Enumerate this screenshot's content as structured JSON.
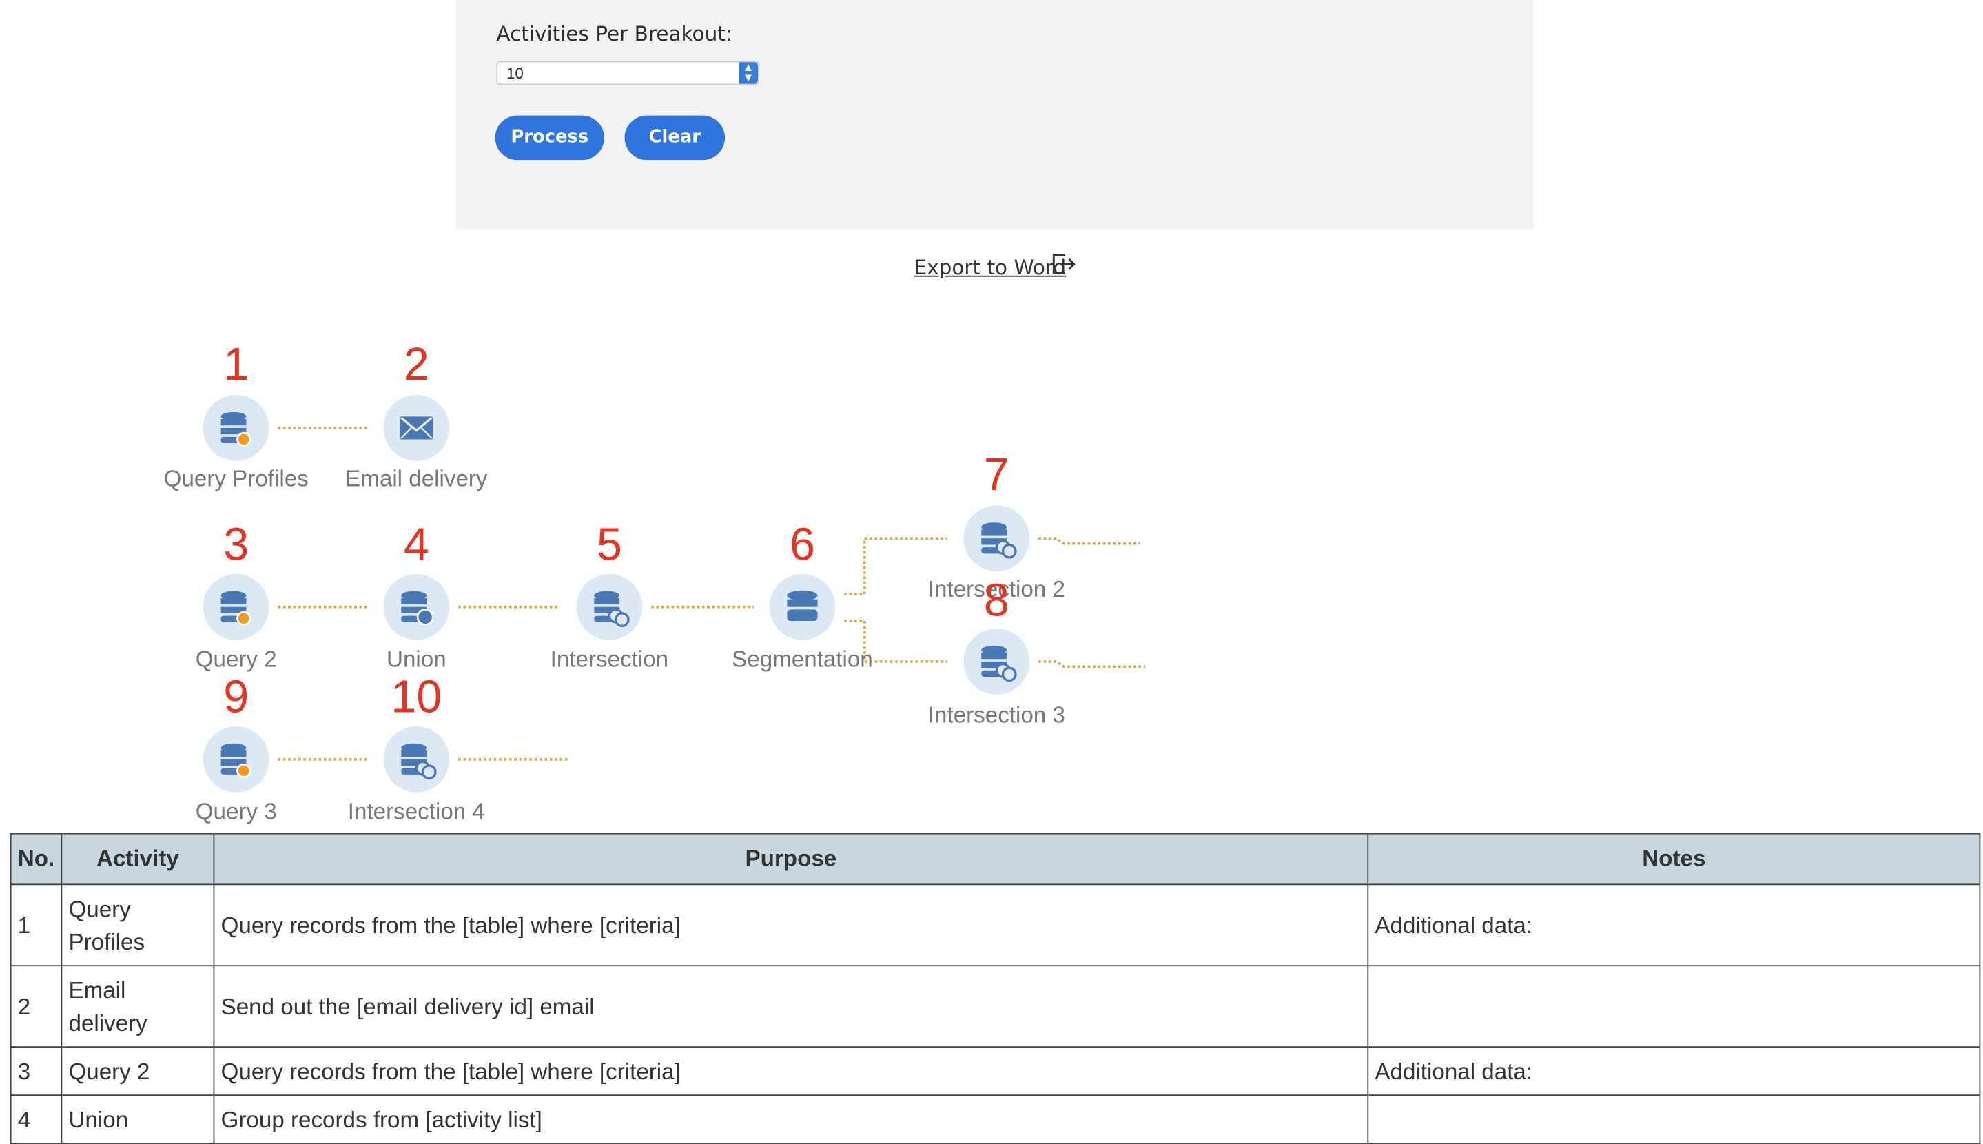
{
  "form": {
    "activities_label": "Activities Per Breakout:",
    "activities_value": "10",
    "process_label": "Process",
    "clear_label": "Clear"
  },
  "export": {
    "label": "Export to Word",
    "icon": "export-icon"
  },
  "workflow": {
    "connector_color": "#e3a33a",
    "number_color": "#e53221",
    "nodes": [
      {
        "num": "1",
        "label": "Query Profiles",
        "icon": "query-icon"
      },
      {
        "num": "2",
        "label": "Email delivery",
        "icon": "email-icon"
      },
      {
        "num": "3",
        "label": "Query 2",
        "icon": "query-icon"
      },
      {
        "num": "4",
        "label": "Union",
        "icon": "union-icon"
      },
      {
        "num": "5",
        "label": "Intersection",
        "icon": "intersection-icon"
      },
      {
        "num": "6",
        "label": "Segmentation",
        "icon": "segmentation-icon"
      },
      {
        "num": "7",
        "label": "Intersection 2",
        "icon": "intersection-icon"
      },
      {
        "num": "8",
        "label": "Intersection 3",
        "icon": "intersection-icon"
      },
      {
        "num": "9",
        "label": "Query 3",
        "icon": "query-icon"
      },
      {
        "num": "10",
        "label": "Intersection 4",
        "icon": "intersection-icon"
      }
    ]
  },
  "table": {
    "headers": [
      "No.",
      "Activity",
      "Purpose",
      "Notes"
    ],
    "rows": [
      {
        "no": "1",
        "activity": "Query Profiles",
        "purpose": "Query records from the [table] where [criteria]",
        "notes": "Additional data:"
      },
      {
        "no": "2",
        "activity": "Email delivery",
        "purpose": "Send out the [email delivery id] email",
        "notes": ""
      },
      {
        "no": "3",
        "activity": "Query 2",
        "purpose": "Query records from the [table] where [criteria]",
        "notes": "Additional data:"
      },
      {
        "no": "4",
        "activity": "Union",
        "purpose": "Group records from [activity list]",
        "notes": ""
      }
    ]
  }
}
